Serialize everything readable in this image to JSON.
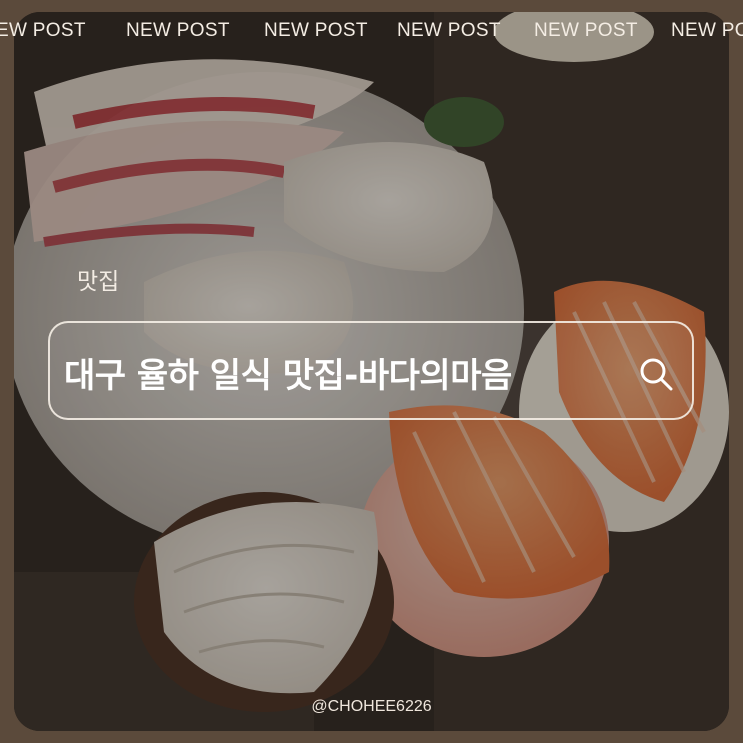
{
  "ticker": {
    "items": [
      "NEW POST",
      "NEW POST",
      "NEW POST",
      "NEW POST",
      "NEW POST",
      "NEW POST"
    ]
  },
  "post": {
    "category": "맛집",
    "title": "대구 율하 일식 맛집-바다의마음"
  },
  "search": {
    "icon": "search-icon"
  },
  "footer": {
    "handle": "@CHOHEE6226"
  },
  "colors": {
    "frame": "#5b4a3b",
    "text": "#ffffff",
    "overlay_text": "#f4ede4"
  }
}
